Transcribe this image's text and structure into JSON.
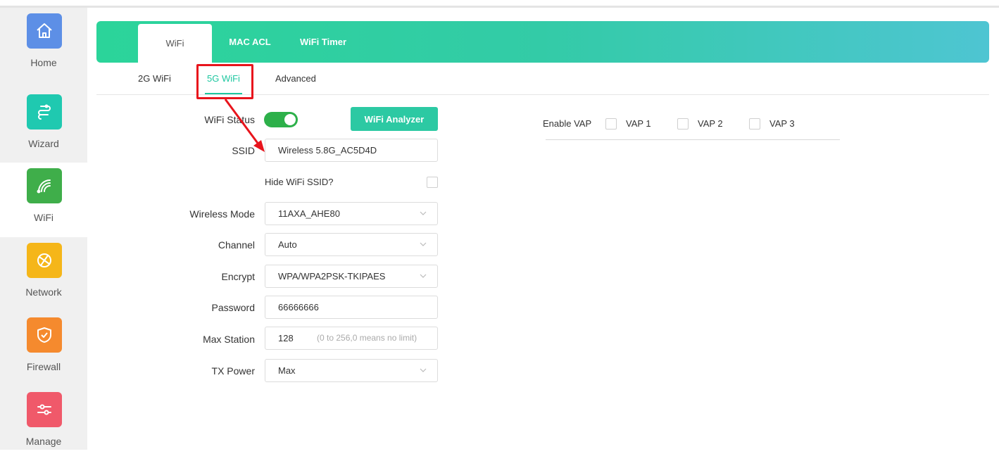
{
  "sidebar": {
    "items": [
      {
        "label": "Home",
        "icon": "home-icon",
        "color": "#5d8fe6"
      },
      {
        "label": "Wizard",
        "icon": "wizard-icon",
        "color": "#1fc9b0"
      },
      {
        "label": "WiFi",
        "icon": "wifi-icon",
        "color": "#3fae4a"
      },
      {
        "label": "Network",
        "icon": "globe-icon",
        "color": "#f5b619"
      },
      {
        "label": "Firewall",
        "icon": "shield-icon",
        "color": "#f58a2e"
      },
      {
        "label": "Manage",
        "icon": "sliders-icon",
        "color": "#f0596a"
      }
    ]
  },
  "top_tabs": [
    "WiFi",
    "MAC ACL",
    "WiFi Timer"
  ],
  "sub_tabs": [
    "2G WiFi",
    "5G WiFi",
    "Advanced"
  ],
  "form": {
    "wifi_status_label": "WiFi Status",
    "wifi_analyzer_label": "WiFi Analyzer",
    "ssid_label": "SSID",
    "ssid_value": "Wireless 5.8G_AC5D4D",
    "hide_ssid_label": "Hide WiFi SSID?",
    "wireless_mode_label": "Wireless Mode",
    "wireless_mode_value": "11AXA_AHE80",
    "channel_label": "Channel",
    "channel_value": "Auto",
    "encrypt_label": "Encrypt",
    "encrypt_value": "WPA/WPA2PSK-TKIPAES",
    "password_label": "Password",
    "password_value": "66666666",
    "max_station_label": "Max Station",
    "max_station_value": "128",
    "max_station_hint": "(0 to 256,0 means no limit)",
    "tx_power_label": "TX Power",
    "tx_power_value": "Max"
  },
  "vap": {
    "enable_label": "Enable VAP",
    "items": [
      "VAP 1",
      "VAP 2",
      "VAP 3"
    ]
  },
  "colors": {
    "accent": "#1ec7a0",
    "toggle_on": "#2db04a",
    "annotation": "#e8141c"
  }
}
